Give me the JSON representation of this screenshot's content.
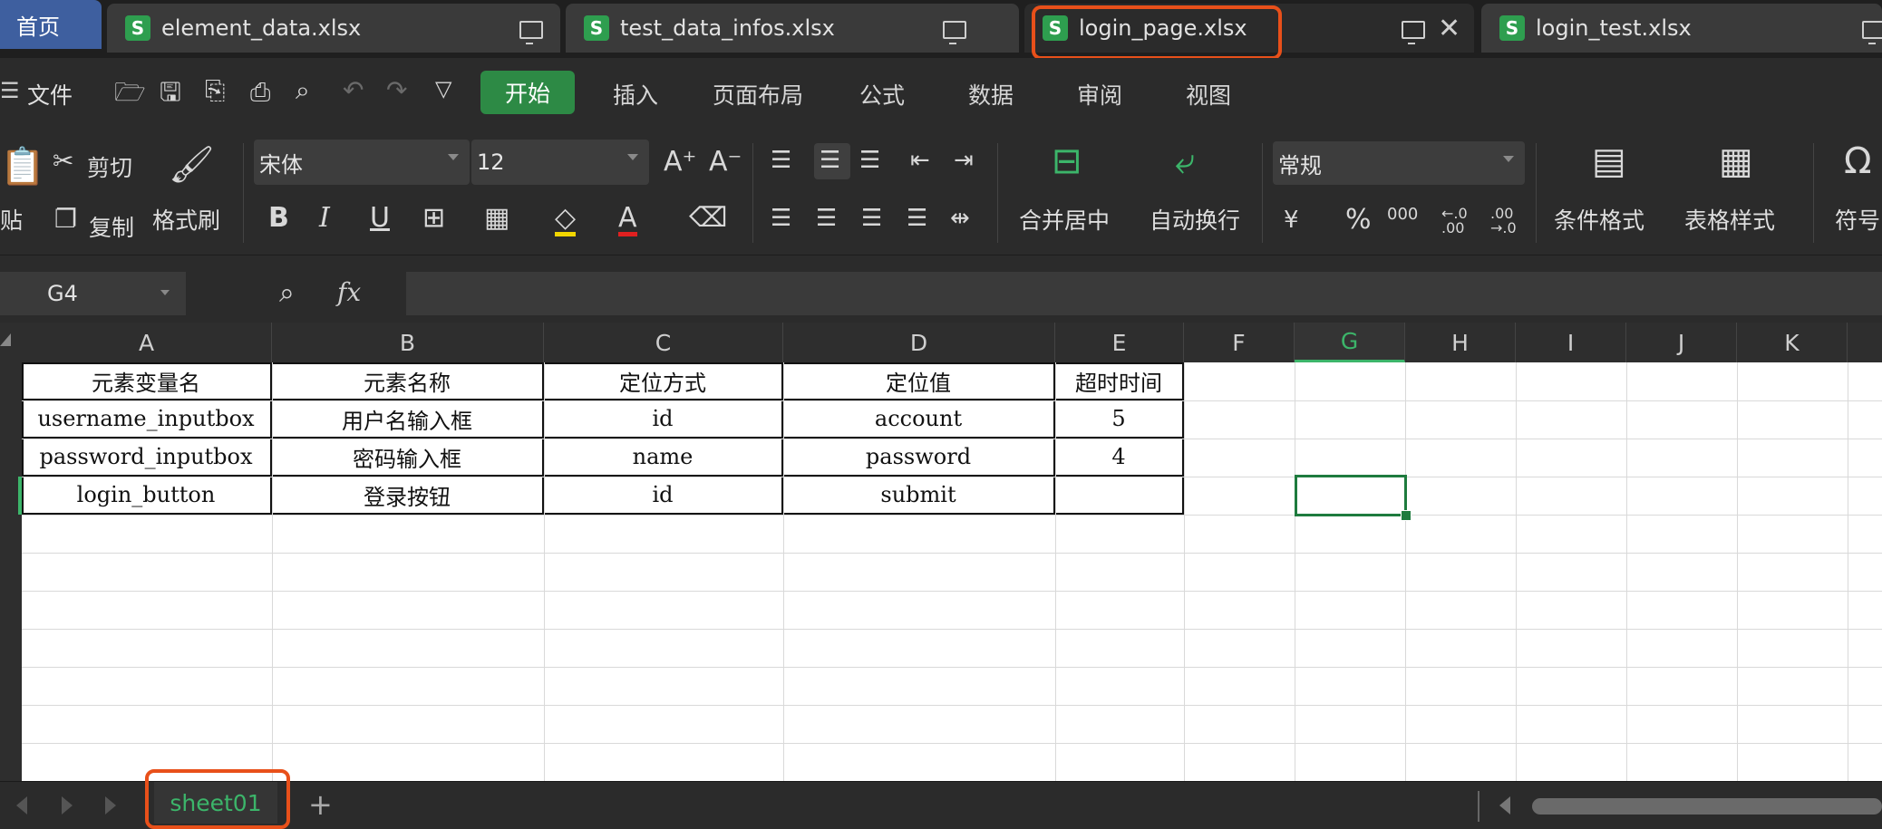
{
  "tabs": {
    "home": "首页",
    "files": [
      {
        "name": "element_data.xlsx"
      },
      {
        "name": "test_data_infos.xlsx"
      },
      {
        "name": "login_page.xlsx"
      },
      {
        "name": "login_test.xlsx"
      }
    ],
    "file_icon_letter": "S"
  },
  "menu": {
    "file": "文件",
    "items": [
      "开始",
      "插入",
      "页面布局",
      "公式",
      "数据",
      "审阅",
      "视图"
    ]
  },
  "ribbon": {
    "paste": "贴",
    "cut": "剪切",
    "copy": "复制",
    "format_painter": "格式刷",
    "font_name": "宋体",
    "font_size": "12",
    "merge_center": "合并居中",
    "wrap_text": "自动换行",
    "number_format": "常规",
    "cond_format": "条件格式",
    "table_style": "表格样式",
    "symbol": "符号",
    "bold": "B",
    "italic": "I",
    "underline": "U",
    "font_color_letter": "A",
    "percent": "%",
    "thousands": "000",
    "currency": "¥",
    "dec_inc": "←.0\n.00",
    "dec_dec": ".00\n→.0"
  },
  "formula_bar": {
    "name_box": "G4",
    "fx": "fx",
    "value": ""
  },
  "columns": [
    "A",
    "B",
    "C",
    "D",
    "E",
    "F",
    "G",
    "H",
    "I",
    "J",
    "K"
  ],
  "selected_column": "G",
  "table": {
    "headers": [
      "元素变量名",
      "元素名称",
      "定位方式",
      "定位值",
      "超时时间"
    ],
    "rows": [
      [
        "username_inputbox",
        "用户名输入框",
        "id",
        "account",
        "5"
      ],
      [
        "password_inputbox",
        "密码输入框",
        "name",
        "password",
        "4"
      ],
      [
        "login_button",
        "登录按钮",
        "id",
        "submit",
        ""
      ]
    ]
  },
  "sheet_tab": "sheet01",
  "colors": {
    "accent_green": "#2d8a45",
    "highlight": "#e8501a",
    "home_tab": "#3e5f9f"
  }
}
